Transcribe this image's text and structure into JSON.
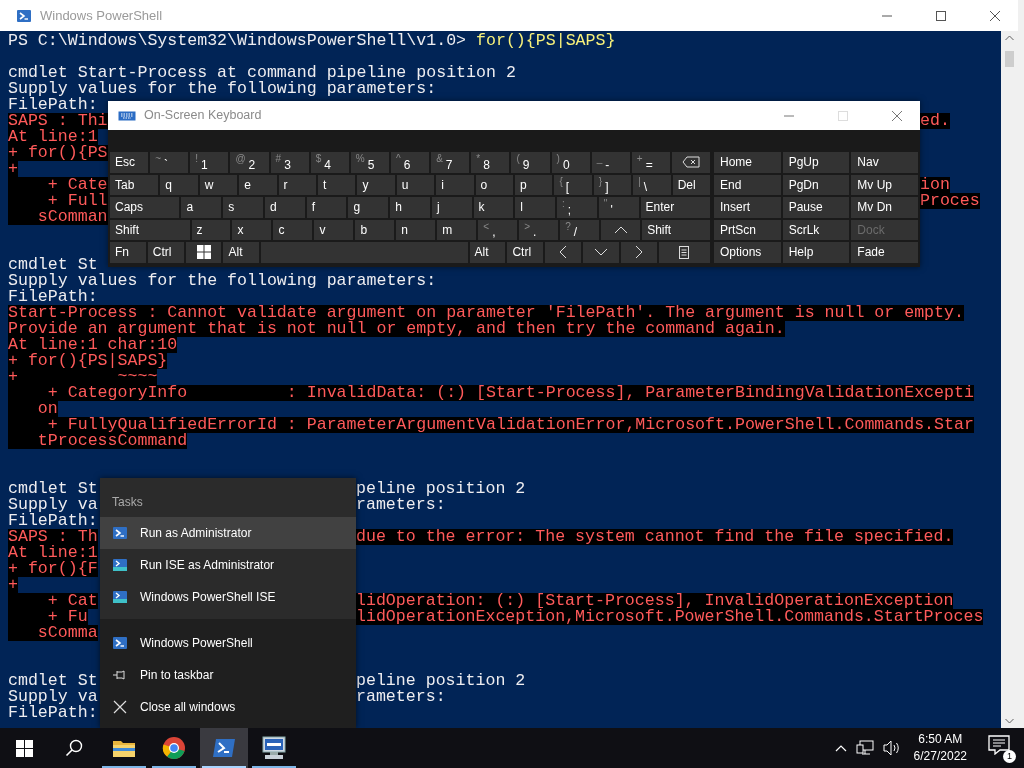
{
  "window": {
    "title": "Windows PowerShell"
  },
  "console": {
    "lines": [
      {
        "kind": "prompt",
        "text": "PS C:\\Windows\\System32\\WindowsPowerShell\\v1.0> ",
        "command": "for(){PS|SAPS}"
      },
      {
        "kind": "blank"
      },
      {
        "kind": "output",
        "text": "cmdlet Start-Process at command pipeline position 2"
      },
      {
        "kind": "output",
        "text": "Supply values for the following parameters:"
      },
      {
        "kind": "output",
        "text": "FilePath:"
      },
      {
        "kind": "error",
        "text": "SAPS : Thi",
        "text_right": "ed."
      },
      {
        "kind": "error",
        "text": "At line:1"
      },
      {
        "kind": "error",
        "text": "+ for(){PS"
      },
      {
        "kind": "error",
        "text": "+"
      },
      {
        "kind": "error",
        "text": "    + Cate",
        "text_right": "ion"
      },
      {
        "kind": "error",
        "text": "    + Full",
        "text_right": "Proces"
      },
      {
        "kind": "error",
        "text": "   sComman"
      },
      {
        "kind": "blank"
      },
      {
        "kind": "blank"
      },
      {
        "kind": "output",
        "text": "cmdlet St"
      },
      {
        "kind": "output",
        "text": "Supply values for the following parameters:"
      },
      {
        "kind": "output",
        "text": "FilePath:"
      },
      {
        "kind": "error",
        "text": "Start-Process : Cannot validate argument on parameter 'FilePath'. The argument is null or empty."
      },
      {
        "kind": "error",
        "text": "Provide an argument that is not null or empty, and then try the command again."
      },
      {
        "kind": "error",
        "text": "At line:1 char:10"
      },
      {
        "kind": "error",
        "text": "+ for(){PS|SAPS}"
      },
      {
        "kind": "error",
        "text": "+          ~~~~"
      },
      {
        "kind": "error",
        "text": "    + CategoryInfo          : InvalidData: (:) [Start-Process], ParameterBindingValidationExcepti"
      },
      {
        "kind": "error",
        "text": "   on"
      },
      {
        "kind": "error",
        "text": "    + FullyQualifiedErrorId : ParameterArgumentValidationError,Microsoft.PowerShell.Commands.Star"
      },
      {
        "kind": "error",
        "text": "   tProcessCommand"
      },
      {
        "kind": "blank"
      },
      {
        "kind": "blank"
      },
      {
        "kind": "output",
        "text": "cmdlet St",
        "text_right": "peline position 2"
      },
      {
        "kind": "output",
        "text": "Supply va",
        "text_right": "rameters:"
      },
      {
        "kind": "output",
        "text": "FilePath:"
      },
      {
        "kind": "error",
        "text": "SAPS : Th",
        "text_right": "due to the error: The system cannot find the file specified."
      },
      {
        "kind": "error",
        "text": "At line:1"
      },
      {
        "kind": "error",
        "text": "+ for(){F"
      },
      {
        "kind": "error",
        "text": "+"
      },
      {
        "kind": "error",
        "text": "    + Cat",
        "text_right": "lidOperation: (:) [Start-Process], InvalidOperationException"
      },
      {
        "kind": "error",
        "text": "    + Fu",
        "text_right": "lidOperationException,Microsoft.PowerShell.Commands.StartProces"
      },
      {
        "kind": "error",
        "text": "   sComma"
      },
      {
        "kind": "blank"
      },
      {
        "kind": "blank"
      },
      {
        "kind": "output",
        "text": "cmdlet St",
        "text_right": "peline position 2"
      },
      {
        "kind": "output",
        "text": "Supply va",
        "text_right": "rameters:"
      },
      {
        "kind": "output",
        "text": "FilePath:"
      }
    ]
  },
  "keyboard": {
    "title": "On-Screen Keyboard",
    "rows": [
      {
        "keys": [
          {
            "kind": "key",
            "label": "Esc"
          },
          {
            "kind": "key",
            "shift": "~",
            "label": "`"
          },
          {
            "kind": "key",
            "shift": "!",
            "label": "1"
          },
          {
            "kind": "key",
            "shift": "@",
            "label": "2"
          },
          {
            "kind": "key",
            "shift": "#",
            "label": "3"
          },
          {
            "kind": "key",
            "shift": "$",
            "label": "4"
          },
          {
            "kind": "key",
            "shift": "%",
            "label": "5"
          },
          {
            "kind": "key",
            "shift": "^",
            "label": "6"
          },
          {
            "kind": "key",
            "shift": "&",
            "label": "7"
          },
          {
            "kind": "key",
            "shift": "*",
            "label": "8"
          },
          {
            "kind": "key",
            "shift": "(",
            "label": "9"
          },
          {
            "kind": "key",
            "shift": ")",
            "label": "0"
          },
          {
            "kind": "key",
            "shift": "_",
            "label": "-"
          },
          {
            "kind": "key",
            "shift": "+",
            "label": "="
          },
          {
            "kind": "backspace"
          }
        ]
      },
      {
        "keys": [
          {
            "kind": "wide",
            "label": "Tab"
          },
          {
            "kind": "key",
            "label": "q"
          },
          {
            "kind": "key",
            "label": "w"
          },
          {
            "kind": "key",
            "label": "e"
          },
          {
            "kind": "key",
            "label": "r"
          },
          {
            "kind": "key",
            "label": "t"
          },
          {
            "kind": "key",
            "label": "y"
          },
          {
            "kind": "key",
            "label": "u"
          },
          {
            "kind": "key",
            "label": "i"
          },
          {
            "kind": "key",
            "label": "o"
          },
          {
            "kind": "key",
            "label": "p"
          },
          {
            "kind": "key",
            "shift": "{",
            "label": "["
          },
          {
            "kind": "key",
            "shift": "}",
            "label": "]"
          },
          {
            "kind": "key",
            "shift": "|",
            "label": "\\"
          },
          {
            "kind": "key",
            "label": "Del"
          }
        ]
      },
      {
        "keys": [
          {
            "kind": "wider",
            "label": "Caps"
          },
          {
            "kind": "key",
            "label": "a"
          },
          {
            "kind": "key",
            "label": "s"
          },
          {
            "kind": "key",
            "label": "d"
          },
          {
            "kind": "key",
            "label": "f"
          },
          {
            "kind": "key",
            "label": "g"
          },
          {
            "kind": "key",
            "label": "h"
          },
          {
            "kind": "key",
            "label": "j"
          },
          {
            "kind": "key",
            "label": "k"
          },
          {
            "kind": "key",
            "label": "l"
          },
          {
            "kind": "key",
            "shift": ":",
            "label": ";"
          },
          {
            "kind": "key",
            "shift": "\"",
            "label": "'"
          },
          {
            "kind": "wider",
            "label": "Enter"
          }
        ]
      },
      {
        "keys": [
          {
            "kind": "widest",
            "label": "Shift"
          },
          {
            "kind": "key",
            "label": "z"
          },
          {
            "kind": "key",
            "label": "x"
          },
          {
            "kind": "key",
            "label": "c"
          },
          {
            "kind": "key",
            "label": "v"
          },
          {
            "kind": "key",
            "label": "b"
          },
          {
            "kind": "key",
            "label": "n"
          },
          {
            "kind": "key",
            "label": "m"
          },
          {
            "kind": "key",
            "shift": "<",
            "label": ","
          },
          {
            "kind": "key",
            "shift": ">",
            "label": "."
          },
          {
            "kind": "key",
            "shift": "?",
            "label": "/"
          },
          {
            "kind": "up"
          },
          {
            "kind": "wider",
            "label": "Shift"
          }
        ]
      },
      {
        "keys": [
          {
            "kind": "key",
            "label": "Fn"
          },
          {
            "kind": "key",
            "label": "Ctrl"
          },
          {
            "kind": "windows"
          },
          {
            "kind": "key",
            "label": "Alt"
          },
          {
            "kind": "space"
          },
          {
            "kind": "key",
            "label": "Alt"
          },
          {
            "kind": "key",
            "label": "Ctrl"
          },
          {
            "kind": "left"
          },
          {
            "kind": "down"
          },
          {
            "kind": "right"
          },
          {
            "kind": "menu"
          }
        ]
      }
    ],
    "side_keys": [
      {
        "label": "Home",
        "disabled": false
      },
      {
        "label": "PgUp",
        "disabled": false
      },
      {
        "label": "Nav",
        "disabled": false
      },
      {
        "label": "End",
        "disabled": false
      },
      {
        "label": "PgDn",
        "disabled": false
      },
      {
        "label": "Mv Up",
        "disabled": false
      },
      {
        "label": "Insert",
        "disabled": false
      },
      {
        "label": "Pause",
        "disabled": false
      },
      {
        "label": "Mv Dn",
        "disabled": false
      },
      {
        "label": "PrtScn",
        "disabled": false
      },
      {
        "label": "ScrLk",
        "disabled": false
      },
      {
        "label": "Dock",
        "disabled": true
      },
      {
        "label": "Options",
        "disabled": false
      },
      {
        "label": "Help",
        "disabled": false
      },
      {
        "label": "Fade",
        "disabled": false
      }
    ]
  },
  "jump_list": {
    "heading": "Tasks",
    "tasks": [
      {
        "kind": "powershell",
        "label": "Run as Administrator",
        "selected": true
      },
      {
        "kind": "ise",
        "label": "Run ISE as Administrator",
        "selected": false
      },
      {
        "kind": "ise",
        "label": "Windows PowerShell ISE",
        "selected": false
      }
    ],
    "actions": [
      {
        "kind": "powershell",
        "label": "Windows PowerShell",
        "selected": false
      },
      {
        "kind": "pin",
        "label": "Pin to taskbar",
        "selected": false
      },
      {
        "kind": "close",
        "label": "Close all windows",
        "selected": false
      }
    ]
  },
  "taskbar": {
    "apps": [
      {
        "kind": "explorer",
        "running": true,
        "selected": false
      },
      {
        "kind": "browser",
        "running": true,
        "selected": false
      },
      {
        "kind": "powershell",
        "running": true,
        "selected": true
      },
      {
        "kind": "computer",
        "running": true,
        "selected": false
      }
    ],
    "time": "6:50 AM",
    "date": "6/27/2022",
    "notification_count": "1"
  }
}
